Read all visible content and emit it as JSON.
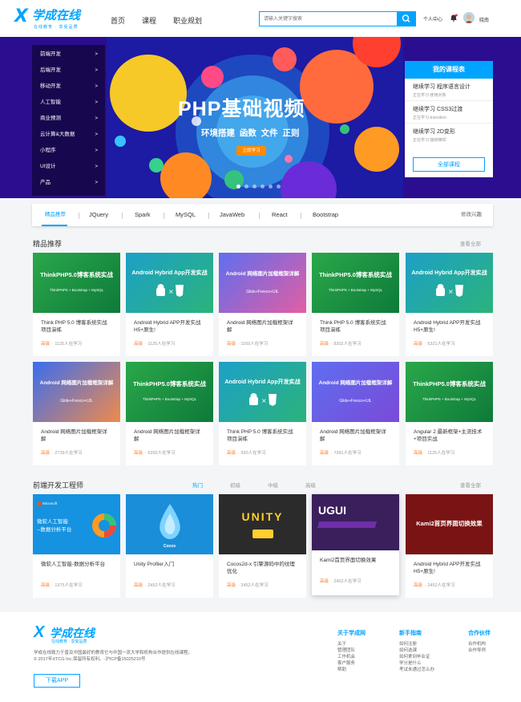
{
  "header": {
    "logo_text": "学成在线",
    "logo_sub": "在线教育 · 享受品质",
    "nav": [
      "首页",
      "课程",
      "职业规划"
    ],
    "search_placeholder": "请输入关键字搜索",
    "user_center": "个人中心",
    "username": "晓南"
  },
  "banner": {
    "headline": "PHP基础视频",
    "subline": "环境搭建  函数  文件  正则",
    "button": "立即学习",
    "accent": "#00a4ff",
    "side_menu": [
      "前端开发",
      "后端开发",
      "移动开发",
      "人工智能",
      "商业预测",
      "云计算&大数据",
      "小程序",
      "UI设计",
      "产品"
    ],
    "my_courses": {
      "title": "我的课程表",
      "items": [
        {
          "name": "继续学习 程序语言设计",
          "sub": "正在学习-使用对象"
        },
        {
          "name": "继续学习 CSS3过渡",
          "sub": "正在学习-transition"
        },
        {
          "name": "继续学习 2D变形",
          "sub": "正在学习-旋转精悍"
        }
      ],
      "all_label": "全部课程"
    }
  },
  "tabs": {
    "items": [
      "精品推荐",
      "JQuery",
      "Spark",
      "MySQL",
      "JavaWeb",
      "React",
      "Bootstrap"
    ],
    "edit": "修改兴趣"
  },
  "featured": {
    "title": "精品推荐",
    "more": "查看全部",
    "level": "高级",
    "cards": [
      {
        "name": "Think PHP 5.0 博客系统实战项目演练",
        "count": "· 1125人在学习",
        "img_title": "ThinkPHP5.0博客系统实战",
        "img_sub": "ThinkPHP5 + Bootstrap + MySQL"
      },
      {
        "name": "Android Hybrid APP开发实战 H5+原生!",
        "count": "· 1125人在学习",
        "img_title": "Android Hybrid App开发实战",
        "img_sub": "HTML5"
      },
      {
        "name": "Android 网络图片加载框架详解",
        "count": "· 1169人在学习",
        "img_title": "Android 网络图片加载框架详解",
        "img_sub": "Glide+Fresco+UIL"
      },
      {
        "name": "Think PHP 5.0 博客系统实战项目演练",
        "count": "· 8302人在学习",
        "img_title": "ThinkPHP5.0博客系统实战",
        "img_sub": "ThinkPHP5 + Bootstrap + MySQL"
      },
      {
        "name": "Android Hybrid APP开发实战 H5+原生!",
        "count": "· 5321人在学习",
        "img_title": "Android Hybrid App开发实战",
        "img_sub": "HTML5"
      },
      {
        "name": "Android 网络图片加载框架详解",
        "count": "· 2739人在学习",
        "img_title": "Android 网络图片加载框架详解",
        "img_sub": "Glide+Fresco+UIL"
      },
      {
        "name": "Android 网络图片加载框架详解",
        "count": "· 6392人在学习",
        "img_title": "ThinkPHP5.0博客系统实战",
        "img_sub": "ThinkPHP5 + Bootstrap + MySQL"
      },
      {
        "name": "Think PHP 5.0 博客系统实战项目演练",
        "count": "· 930人在学习",
        "img_title": "Android Hybrid App开发实战",
        "img_sub": "HTML5"
      },
      {
        "name": "Android 网络图片加载框架详解",
        "count": "· 7391人在学习",
        "img_title": "Android 网络图片加载框架详解",
        "img_sub": "Glide+Fresco+UIL"
      },
      {
        "name": "Angular 2 最新框架+主流技术+项目实战",
        "count": "· 1125人在学习",
        "img_title": "ThinkPHP5.0博客系统实战",
        "img_sub": "ThinkPHP5 + Bootstrap + MySQL"
      }
    ]
  },
  "frontend": {
    "title": "前端开发工程师",
    "subtabs": [
      "热门",
      "初级",
      "中级",
      "高级"
    ],
    "more": "查看全部",
    "level": "高级",
    "cards": [
      {
        "name": "微软人工智能-数据分析平台",
        "count": "· 1375人在学习",
        "img_title": "微软人工智能\n--数据分析平台"
      },
      {
        "name": "Unity Profiler入门",
        "count": "· 2452人在学习",
        "img_title": "Cocos"
      },
      {
        "name": "Cocos2d-x 引擎源码中的纹理优化",
        "count": "· 2452人在学习",
        "img_title": "UNITY"
      },
      {
        "name": "Kami2首页界面切换效果",
        "count": "· 2452人在学习",
        "img_title": "UGUI"
      },
      {
        "name": "Android Hybrid APP开发实战 H5+原生!",
        "count": "· 2452人在学习",
        "img_title": "Kami2首页界面切换效果"
      }
    ]
  },
  "footer": {
    "desc1": "学成在线致力于普及中国最好的教育它与中国一流大学和机构合作提供在线课程。",
    "desc2": "© 2017年XTCG Inc.保留所有权利。-沪ICP备15025210号",
    "app_button": "下载APP",
    "cols": [
      {
        "title": "关于学成网",
        "links": [
          "关于",
          "管理团队",
          "工作机会",
          "客户服务",
          "帮助"
        ]
      },
      {
        "title": "新手指南",
        "links": [
          "如何注册",
          "如何选课",
          "如何拿到毕业证",
          "学分是什么",
          "考试未通过怎么办"
        ]
      },
      {
        "title": "合作伙伴",
        "links": [
          "合作机构",
          "合作导师"
        ]
      }
    ]
  }
}
